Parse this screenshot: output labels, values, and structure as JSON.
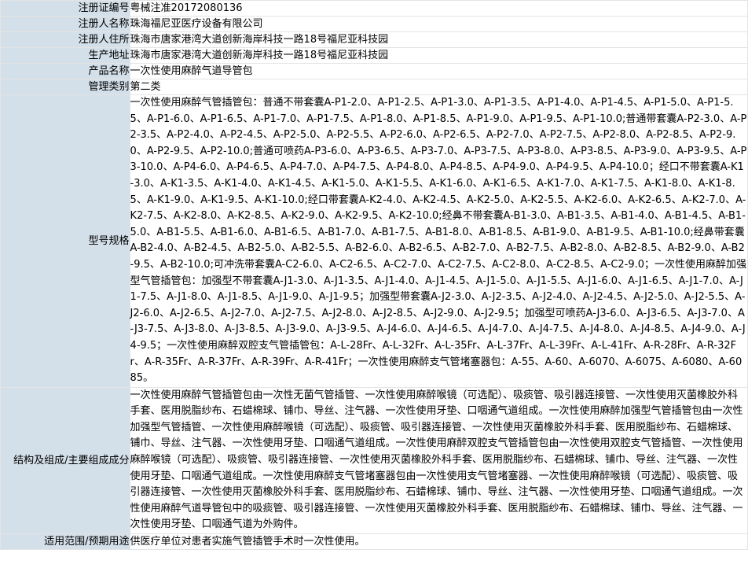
{
  "rows": [
    {
      "label": "注册证编号",
      "value": "粤械注准20172080136"
    },
    {
      "label": "注册人名称",
      "value": "珠海福尼亚医疗设备有限公司"
    },
    {
      "label": "注册人住所",
      "value": "珠海市唐家港湾大道创新海岸科技一路18号福尼亚科技园"
    },
    {
      "label": "生产地址",
      "value": "珠海市唐家港湾大道创新海岸科技一路18号福尼亚科技园"
    },
    {
      "label": "产品名称",
      "value": "一次性使用麻醉气道导管包"
    },
    {
      "label": "管理类别",
      "value": "第二类"
    },
    {
      "label": "型号规格",
      "value": "一次性使用麻醉气管插管包：普通不带套囊A-P1-2.0、A-P1-2.5、A-P1-3.0、A-P1-3.5、A-P1-4.0、A-P1-4.5、A-P1-5.0、A-P1-5.5、A-P1-6.0、A-P1-6.5、A-P1-7.0、A-P1-7.5、A-P1-8.0、A-P1-8.5、A-P1-9.0、A-P1-9.5、A-P1-10.0;普通带套囊A-P2-3.0、A-P2-3.5、A-P2-4.0、A-P2-4.5、A-P2-5.0、A-P2-5.5、A-P2-6.0、A-P2-6.5、A-P2-7.0、A-P2-7.5、A-P2-8.0、A-P2-8.5、A-P2-9.0、A-P2-9.5、A-P2-10.0;普通可喷药A-P3-6.0、A-P3-6.5、A-P3-7.0、A-P3-7.5、A-P3-8.0、A-P3-8.5、A-P3-9.0、A-P3-9.5、A-P3-10.0、A-P4-6.0、A-P4-6.5、A-P4-7.0、A-P4-7.5、A-P4-8.0、A-P4-8.5、A-P4-9.0、A-P4-9.5、A-P4-10.0；经口不带套囊A-K1-3.0、A-K1-3.5、A-K1-4.0、A-K1-4.5、A-K1-5.0、A-K1-5.5、A-K1-6.0、A-K1-6.5、A-K1-7.0、A-K1-7.5、A-K1-8.0、A-K1-8.5、A-K1-9.0、A-K1-9.5、A-K1-10.0;经口带套囊A-K2-4.0、A-K2-4.5、A-K2-5.0、A-K2-5.5、A-K2-6.0、A-K2-6.5、A-K2-7.0、A-K2-7.5、A-K2-8.0、A-K2-8.5、A-K2-9.0、A-K2-9.5、A-K2-10.0;经鼻不带套囊A-B1-3.0、A-B1-3.5、A-B1-4.0、A-B1-4.5、A-B1-5.0、A-B1-5.5、A-B1-6.0、A-B1-6.5、A-B1-7.0、A-B1-7.5、A-B1-8.0、A-B1-8.5、A-B1-9.0、A-B1-9.5、A-B1-10.0;经鼻带套囊A-B2-4.0、A-B2-4.5、A-B2-5.0、A-B2-5.5、A-B2-6.0、A-B2-6.5、A-B2-7.0、A-B2-7.5、A-B2-8.0、A-B2-8.5、A-B2-9.0、A-B2-9.5、A-B2-10.0;可冲洗带套囊A-C2-6.0、A-C2-6.5、A-C2-7.0、A-C2-7.5、A-C2-8.0、A-C2-8.5、A-C2-9.0；一次性使用麻醉加强型气管插管包：加强型不带套囊A-J1-3.0、A-J1-3.5、A-J1-4.0、A-J1-4.5、A-J1-5.0、A-J1-5.5、A-J1-6.0、A-J1-6.5、A-J1-7.0、A-J1-7.5、A-J1-8.0、A-J1-8.5、A-J1-9.0、A-J1-9.5；加强型带套囊A-J2-3.0、A-J2-3.5、A-J2-4.0、A-J2-4.5、A-J2-5.0、A-J2-5.5、A-J2-6.0、A-J2-6.5、A-J2-7.0、A-J2-7.5、A-J2-8.0、A-J2-8.5、A-J2-9.0、A-J2-9.5；加强型可喷药A-J3-6.0、A-J3-6.5、A-J3-7.0、A-J3-7.5、A-J3-8.0、A-J3-8.5、A-J3-9.0、A-J3-9.5、A-J4-6.0、A-J4-6.5、A-J4-7.0、A-J4-7.5、A-J4-8.0、A-J4-8.5、A-J4-9.0、A-J4-9.5；一次性使用麻醉双腔支气管插管包：A-L-28Fr、A-L-32Fr、A-L-35Fr、A-L-37Fr、A-L-39Fr、A-L-41Fr、A-R-28Fr、A-R-32Fr、A-R-35Fr、A-R-37Fr、A-R-39Fr、A-R-41Fr；一次性使用麻醉支气管堵塞器包：A-55、A-60、A-6070、A-6075、A-6080、A-6085。"
    },
    {
      "label": "结构及组成/主要组成成分",
      "value": "一次性使用麻醉气管插管包由一次性无菌气管插管、一次性使用麻醉喉镜（可选配）、吸痰管、吸引器连接管、一次性使用灭菌橡胶外科手套、医用脱脂纱布、石蜡棉球、铺巾、导丝、注气器、一次性使用牙垫、口咽通气道组成。一次性使用麻醉加强型气管插管包由一次性加强型气管插管、一次性使用麻醉喉镜（可选配）、吸痰管、吸引器连接管、一次性使用灭菌橡胶外科手套、医用脱脂纱布、石蜡棉球、铺巾、导丝、注气器、一次性使用牙垫、口咽通气道组成。一次性使用麻醉双腔支气管插管包由一次性使用双腔支气管插管、一次性使用麻醉喉镜（可选配）、吸痰管、吸引器连接管、一次性使用灭菌橡胶外科手套、医用脱脂纱布、石蜡棉球、铺巾、导丝、注气器、一次性使用牙垫、口咽通气道组成。一次性使用麻醉支气管堵塞器包由一次性使用支气管堵塞器、一次性使用麻醉喉镜（可选配）、吸痰管、吸引器连接管、一次性使用灭菌橡胶外科手套、医用脱脂纱布、石蜡棉球、铺巾、导丝、注气器、一次性使用牙垫、口咽通气道组成。一次性使用麻醉气道导管包中的吸痰管、吸引器连接管、一次性使用灭菌橡胶外科手套、医用脱脂纱布、石蜡棉球、铺巾、导丝、注气器、一次性使用牙垫、口咽通气道为外购件。"
    },
    {
      "label": "适用范围/预期用途",
      "value": "供医疗单位对患者实施气管插管手术时一次性使用。"
    }
  ]
}
